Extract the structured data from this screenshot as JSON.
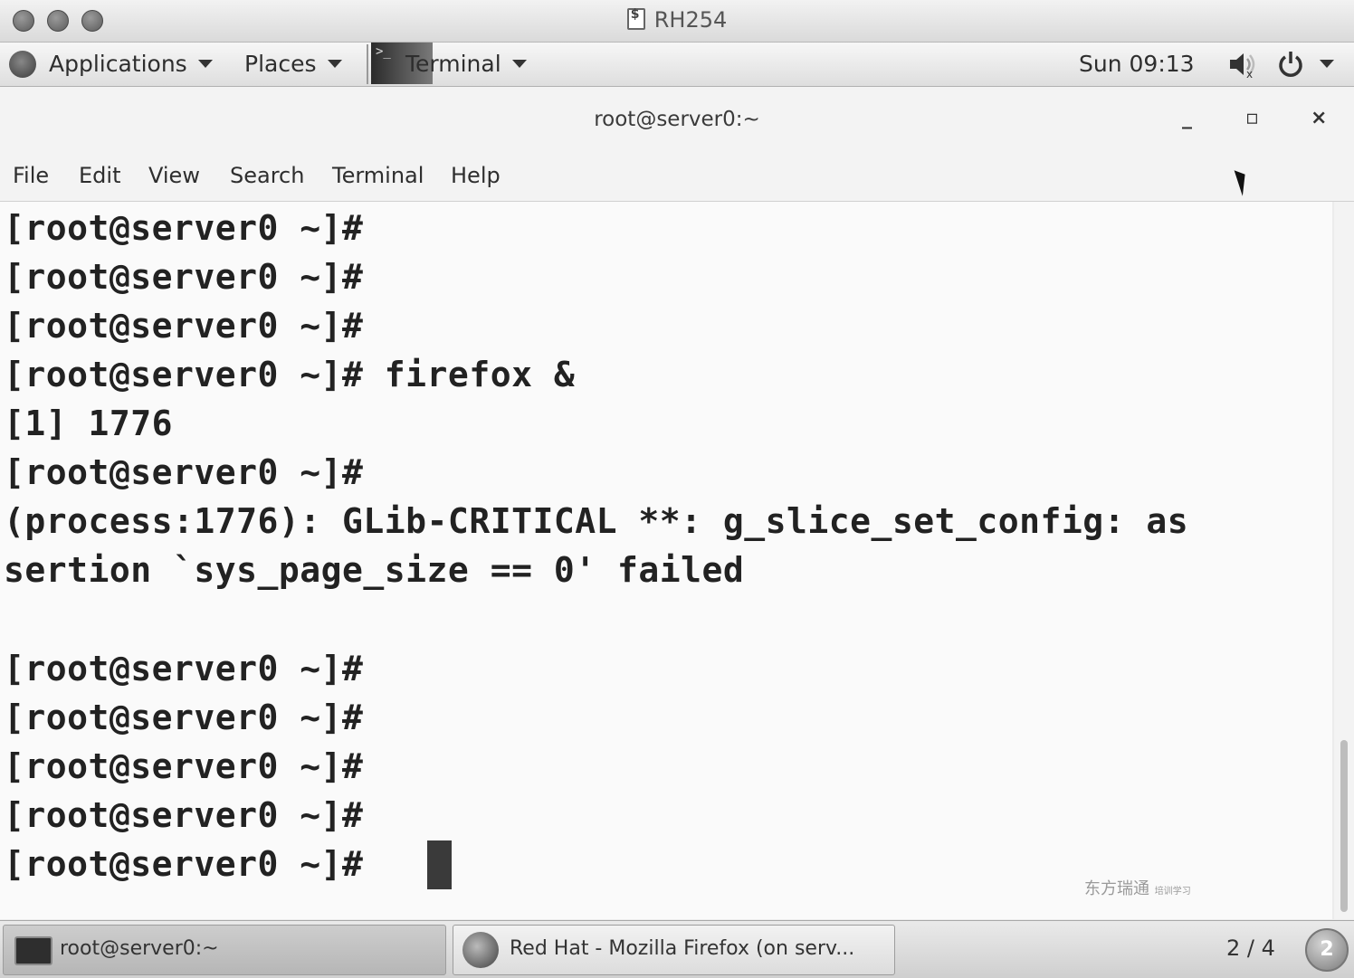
{
  "vm_window": {
    "title": "RH254"
  },
  "top_panel": {
    "applications_label": "Applications",
    "places_label": "Places",
    "active_app_label": "Terminal",
    "clock": "Sun 09:13"
  },
  "terminal_window": {
    "title": "root@server0:~",
    "minimize": "_",
    "maximize": "▫",
    "close": "×",
    "menu": [
      "File",
      "Edit",
      "View",
      "Search",
      "Terminal",
      "Help"
    ]
  },
  "terminal_lines": [
    "[root@server0 ~]#",
    "[root@server0 ~]#",
    "[root@server0 ~]#",
    "[root@server0 ~]# firefox &",
    "[1] 1776",
    "[root@server0 ~]#",
    "(process:1776): GLib-CRITICAL **: g_slice_set_config: as",
    "sertion `sys_page_size == 0' failed",
    "",
    "[root@server0 ~]#",
    "[root@server0 ~]#",
    "[root@server0 ~]#",
    "[root@server0 ~]#",
    "[root@server0 ~]#"
  ],
  "watermark": {
    "text": "东方瑞通",
    "sub": "培训学习"
  },
  "taskbar": {
    "tasks": [
      {
        "label": "root@server0:~",
        "active": true
      },
      {
        "label": "Red Hat - Mozilla Firefox (on serv...",
        "active": false
      }
    ],
    "workspace_indicator": "2 / 4",
    "workspace_button": "2"
  }
}
